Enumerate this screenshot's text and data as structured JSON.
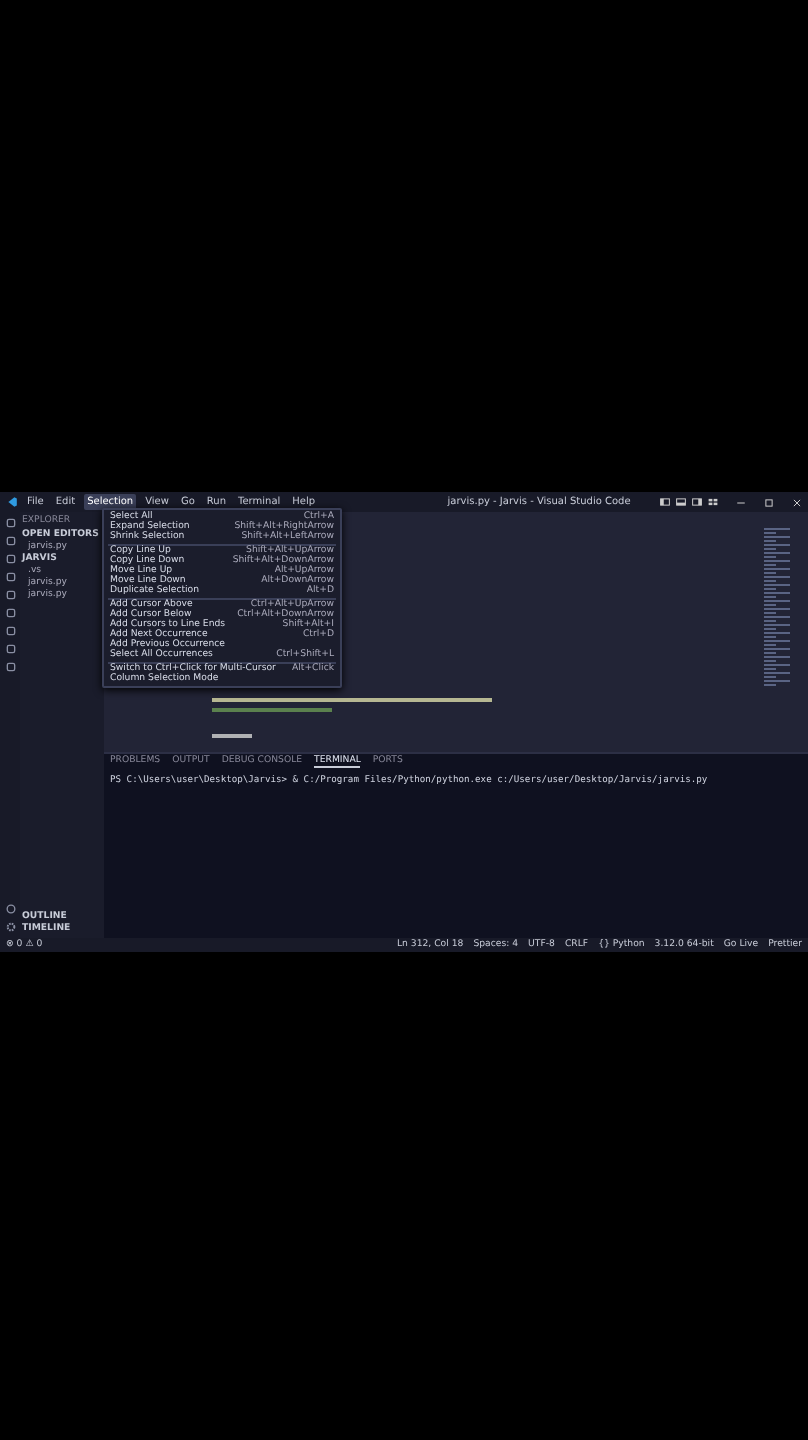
{
  "title_bar": {
    "menus": [
      {
        "label": "File",
        "selected": false
      },
      {
        "label": "Edit",
        "selected": false
      },
      {
        "label": "Selection",
        "selected": true
      },
      {
        "label": "View",
        "selected": false
      },
      {
        "label": "Go",
        "selected": false
      },
      {
        "label": "Run",
        "selected": false
      },
      {
        "label": "Terminal",
        "selected": false
      },
      {
        "label": "Help",
        "selected": false
      }
    ],
    "title": "jarvis.py - Jarvis - Visual Studio Code"
  },
  "selection_menu": {
    "groups": [
      [
        {
          "label": "Select All",
          "shortcut": "Ctrl+A"
        },
        {
          "label": "Expand Selection",
          "shortcut": "Shift+Alt+RightArrow"
        },
        {
          "label": "Shrink Selection",
          "shortcut": "Shift+Alt+LeftArrow"
        }
      ],
      [
        {
          "label": "Copy Line Up",
          "shortcut": "Shift+Alt+UpArrow"
        },
        {
          "label": "Copy Line Down",
          "shortcut": "Shift+Alt+DownArrow"
        },
        {
          "label": "Move Line Up",
          "shortcut": "Alt+UpArrow"
        },
        {
          "label": "Move Line Down",
          "shortcut": "Alt+DownArrow"
        },
        {
          "label": "Duplicate Selection",
          "shortcut": "Alt+D"
        }
      ],
      [
        {
          "label": "Add Cursor Above",
          "shortcut": "Ctrl+Alt+UpArrow"
        },
        {
          "label": "Add Cursor Below",
          "shortcut": "Ctrl+Alt+DownArrow"
        },
        {
          "label": "Add Cursors to Line Ends",
          "shortcut": "Shift+Alt+I"
        },
        {
          "label": "Add Next Occurrence",
          "shortcut": "Ctrl+D"
        },
        {
          "label": "Add Previous Occurrence"
        },
        {
          "label": "Select All Occurrences",
          "shortcut": "Ctrl+Shift+L"
        }
      ],
      [
        {
          "label": "Switch to Ctrl+Click for Multi-Cursor",
          "shortcut": "Alt+Click"
        },
        {
          "label": "Column Selection Mode"
        }
      ]
    ]
  },
  "sidebar": {
    "title": "EXPLORER",
    "sections": [
      {
        "label": "OPEN EDITORS",
        "items": [
          "jarvis.py"
        ]
      },
      {
        "label": "JARVIS",
        "items": [
          ".vs",
          "jarvis.py",
          "jarvis.py"
        ]
      }
    ],
    "footer": [
      "OUTLINE",
      "TIMELINE"
    ]
  },
  "panel": {
    "tabs": [
      {
        "label": "PROBLEMS",
        "selected": false
      },
      {
        "label": "OUTPUT",
        "selected": false
      },
      {
        "label": "DEBUG CONSOLE",
        "selected": false
      },
      {
        "label": "TERMINAL",
        "selected": true
      },
      {
        "label": "PORTS",
        "selected": false
      }
    ],
    "terminal_lines": [
      "PS C:\\Users\\user\\Desktop\\Jarvis> & C:/Program Files/Python/python.exe c:/Users/user/Desktop/Jarvis/jarvis.py"
    ]
  },
  "status_bar": {
    "left": [
      "⊗ 0 ⚠ 0"
    ],
    "right": [
      "Ln 312, Col 18",
      "Spaces: 4",
      "UTF-8",
      "CRLF",
      "{} Python",
      "3.12.0 64-bit",
      "Go Live",
      "Prettier"
    ]
  }
}
